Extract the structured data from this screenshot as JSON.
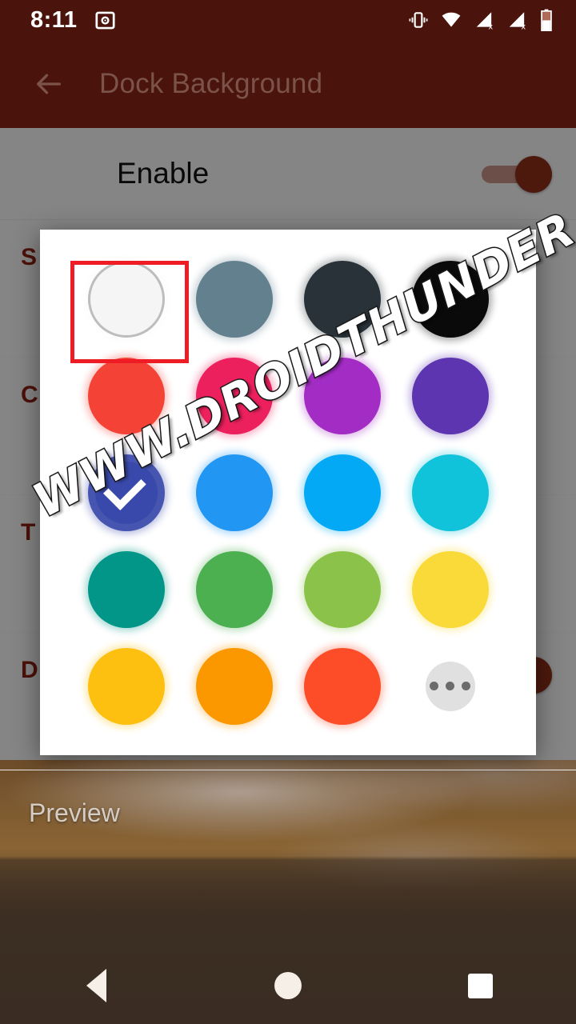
{
  "status_bar": {
    "time": "8:11",
    "left_icons": [
      "safe-vault-icon"
    ],
    "right_icons": [
      "vibrate-icon",
      "wifi-icon",
      "signal-no-sim-1-icon",
      "signal-no-sim-2-icon",
      "battery-icon"
    ],
    "background_color": "#4a130b"
  },
  "app_bar": {
    "back_label": "back-arrow",
    "title": "Dock Background",
    "background_color": "#4a130b",
    "title_color": "#7b5349"
  },
  "settings": {
    "enable_row": {
      "label": "Enable",
      "switch_state": "on",
      "switch_color": "#8e2f18"
    },
    "items": [
      {
        "title": "S",
        "subtitle": ""
      },
      {
        "title": "C",
        "subtitle": ""
      },
      {
        "title": "T",
        "subtitle": ""
      },
      {
        "title": "D",
        "subtitle": ""
      }
    ]
  },
  "preview": {
    "label": "Preview"
  },
  "color_dialog": {
    "selected_index": 8,
    "highlight_index": 0,
    "highlight_color": "#ee1c24",
    "swatches": [
      {
        "name": "white",
        "color": "#f5f5f5",
        "ring": true,
        "type": "color"
      },
      {
        "name": "blue-grey",
        "color": "#63808f",
        "ring": false,
        "type": "color"
      },
      {
        "name": "charcoal",
        "color": "#283238",
        "ring": false,
        "type": "color"
      },
      {
        "name": "black",
        "color": "#0a0a0a",
        "ring": false,
        "type": "color"
      },
      {
        "name": "red",
        "color": "#f44336",
        "ring": false,
        "type": "color"
      },
      {
        "name": "pink",
        "color": "#ec205d",
        "ring": false,
        "type": "color"
      },
      {
        "name": "purple",
        "color": "#a32cc4",
        "ring": false,
        "type": "color"
      },
      {
        "name": "deep-purple",
        "color": "#5e35b1",
        "ring": false,
        "type": "color"
      },
      {
        "name": "indigo",
        "color": "#3949ab",
        "ring": false,
        "type": "color"
      },
      {
        "name": "blue",
        "color": "#2196f3",
        "ring": false,
        "type": "color"
      },
      {
        "name": "light-blue",
        "color": "#03a9f4",
        "ring": false,
        "type": "color"
      },
      {
        "name": "cyan",
        "color": "#11c3da",
        "ring": false,
        "type": "color"
      },
      {
        "name": "teal",
        "color": "#019688",
        "ring": false,
        "type": "color"
      },
      {
        "name": "green",
        "color": "#4caf50",
        "ring": false,
        "type": "color"
      },
      {
        "name": "light-green",
        "color": "#8bc34a",
        "ring": false,
        "type": "color"
      },
      {
        "name": "yellow",
        "color": "#fada38",
        "ring": false,
        "type": "color"
      },
      {
        "name": "amber",
        "color": "#fdc010",
        "ring": false,
        "type": "color"
      },
      {
        "name": "orange",
        "color": "#fb9800",
        "ring": false,
        "type": "color"
      },
      {
        "name": "deep-orange",
        "color": "#fc4c28",
        "ring": false,
        "type": "color"
      },
      {
        "name": "more-colors",
        "color": "#e0e0e0",
        "ring": false,
        "type": "more"
      }
    ]
  },
  "watermark": {
    "text": "WWW.DROIDTHUNDER.COM"
  },
  "nav_bar": {
    "buttons": [
      "back-nav-icon",
      "home-nav-icon",
      "recents-nav-icon"
    ]
  }
}
